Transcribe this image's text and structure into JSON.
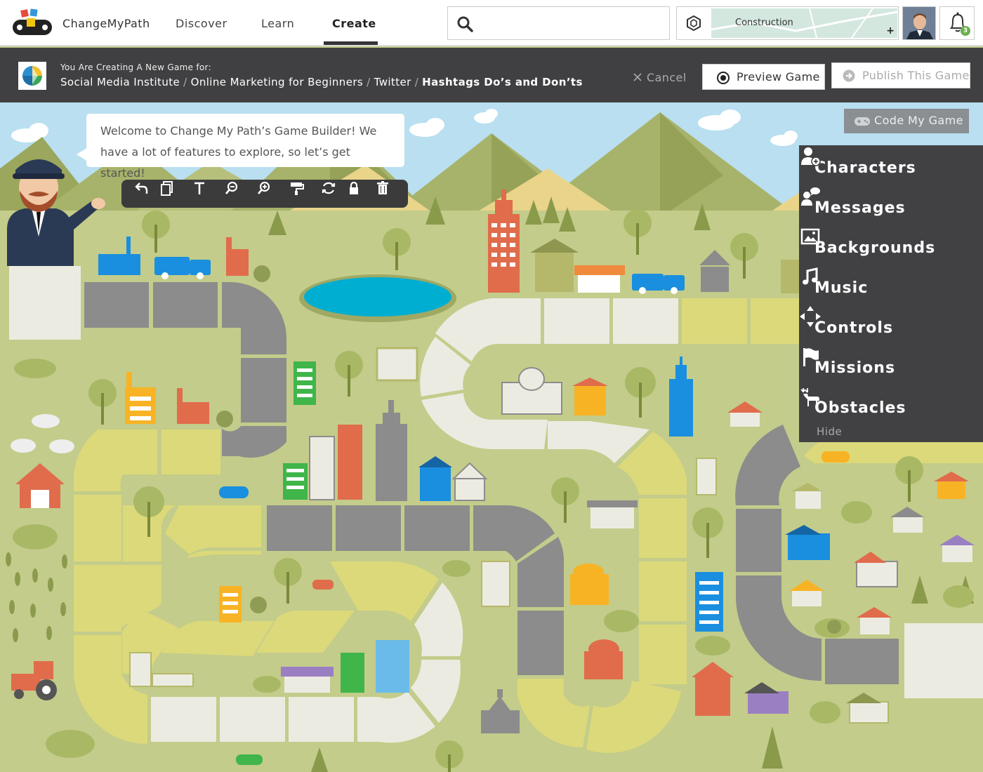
{
  "topnav": {
    "brand": "ChangeMyPath",
    "links": [
      {
        "label": "Discover"
      },
      {
        "label": "Learn"
      },
      {
        "label": "Create"
      }
    ],
    "search": {
      "placeholder": ""
    },
    "project": {
      "label": "Construction"
    },
    "notifications": {
      "count": "3"
    }
  },
  "header": {
    "subtitle": "You Are Creating A New Game for:",
    "breadcrumb": [
      "Social Media Institute",
      "Online Marketing for Beginners",
      "Twitter",
      "Hashtags Do’s and Don’ts"
    ],
    "cancel_label": "Cancel",
    "preview_label": "Preview Game",
    "publish_label": "Publish This Game"
  },
  "builder": {
    "welcome_message": "Welcome to Change My Path’s Game Builder! We have a lot of features to explore, so let’s get started!",
    "toolbar_tools": [
      "undo-icon",
      "duplicate-icon",
      "text-icon",
      "zoom-out-icon",
      "zoom-in-icon",
      "paint-roller-icon",
      "rotate-icon",
      "lock-icon",
      "trash-icon"
    ],
    "code_label": "Code My Game"
  },
  "panel": {
    "items": [
      {
        "label": "Characters",
        "icon": "add-character-icon"
      },
      {
        "label": "Messages",
        "icon": "message-character-icon"
      },
      {
        "label": "Backgrounds",
        "icon": "image-icon"
      },
      {
        "label": "Music",
        "icon": "music-note-icon"
      },
      {
        "label": "Controls",
        "icon": "arrows-icon"
      },
      {
        "label": "Missions",
        "icon": "flag-icon"
      },
      {
        "label": "Obstacles",
        "icon": "reindeer-icon"
      }
    ],
    "hide_label": "Hide"
  },
  "colors": {
    "accent_dark": "#404042",
    "panel_bg": "#414143",
    "grass": "#c3cc8a",
    "sky": "#b9dff0",
    "mountain": "#a7b36a",
    "road_grey": "#8c8c8c",
    "road_light": "#ecebe2",
    "road_yellow": "#dcd97a",
    "notification_green": "#6ab04c"
  }
}
